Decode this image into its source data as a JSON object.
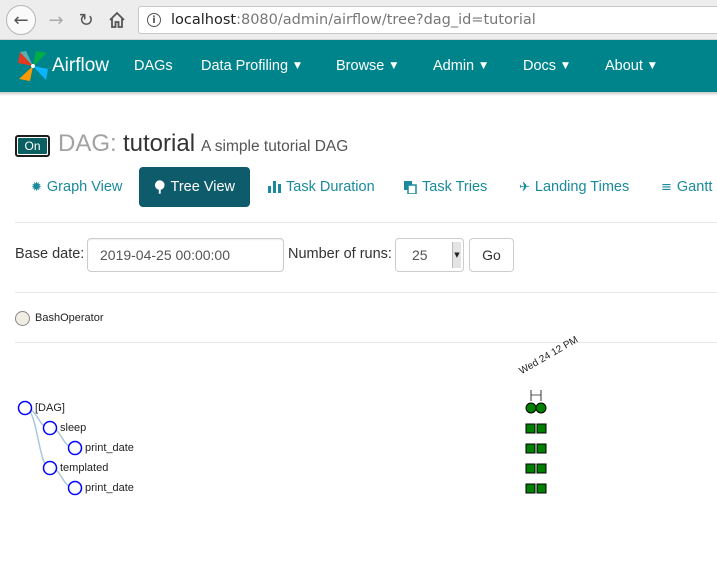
{
  "browser": {
    "url_host": "localhost",
    "url_rest": ":8080/admin/airflow/tree?dag_id=tutorial"
  },
  "navbar": {
    "brand": "Airflow",
    "items": [
      {
        "label": "DAGs",
        "dropdown": false
      },
      {
        "label": "Data Profiling",
        "dropdown": true
      },
      {
        "label": "Browse",
        "dropdown": true
      },
      {
        "label": "Admin",
        "dropdown": true
      },
      {
        "label": "Docs",
        "dropdown": true
      },
      {
        "label": "About",
        "dropdown": true
      }
    ]
  },
  "header": {
    "toggle_label": "On",
    "dag_prefix": "DAG:",
    "dag_id": "tutorial",
    "description": "A simple tutorial DAG"
  },
  "tabs": [
    {
      "label": "Graph View",
      "icon": "sun-icon",
      "active": false
    },
    {
      "label": "Tree View",
      "icon": "tree-icon",
      "active": true
    },
    {
      "label": "Task Duration",
      "icon": "bar-chart-icon",
      "active": false
    },
    {
      "label": "Task Tries",
      "icon": "duplicate-icon",
      "active": false
    },
    {
      "label": "Landing Times",
      "icon": "plane-icon",
      "active": false
    },
    {
      "label": "Gantt",
      "icon": "align-left-icon",
      "active": false
    }
  ],
  "form": {
    "base_date_label": "Base date:",
    "base_date_value": "2019-04-25 00:00:00",
    "runs_label": "Number of runs:",
    "runs_value": "25",
    "go_label": "Go"
  },
  "legend": {
    "operator": "BashOperator"
  },
  "tree": {
    "run_header": "Wed 24 12 PM",
    "nodes": [
      {
        "label": "[DAG]",
        "depth": 0
      },
      {
        "label": "sleep",
        "depth": 1
      },
      {
        "label": "print_date",
        "depth": 2
      },
      {
        "label": "templated",
        "depth": 1
      },
      {
        "label": "print_date",
        "depth": 2
      }
    ]
  },
  "colors": {
    "navbar": "#00848c",
    "success": "#008000",
    "node_stroke": "#0000ff",
    "link": "#1b8a9c"
  }
}
